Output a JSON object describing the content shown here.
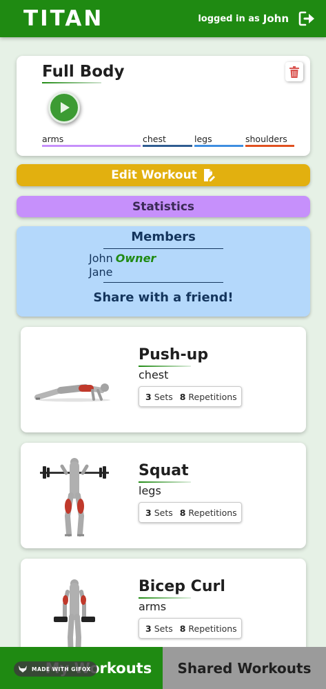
{
  "header": {
    "brand": "TITAN",
    "login_text": "logged in as",
    "username": "John",
    "logout_icon": "sign-out-icon"
  },
  "workout": {
    "title": "Full Body",
    "delete_icon": "trash-icon",
    "play_icon": "play-icon",
    "tags": [
      {
        "label": "arms",
        "color": "#c690fb"
      },
      {
        "label": "chest",
        "color": "#2f5c91"
      },
      {
        "label": "legs",
        "color": "#3e8ee0"
      },
      {
        "label": "shoulders",
        "color": "#e0501f"
      }
    ]
  },
  "actions": {
    "edit_label": "Edit Workout",
    "edit_icon": "file-edit-icon",
    "stats_label": "Statistics"
  },
  "members": {
    "title": "Members",
    "list": [
      {
        "name": "John",
        "role": "Owner"
      },
      {
        "name": "Jane",
        "role": ""
      }
    ],
    "share_label": "Share with a friend!"
  },
  "exercises": [
    {
      "name": "Push-up",
      "muscle": "chest",
      "sets": "3",
      "sets_label": "Sets",
      "reps": "8",
      "reps_label": "Repetitions",
      "image": "push-up-illustration"
    },
    {
      "name": "Squat",
      "muscle": "legs",
      "sets": "3",
      "sets_label": "Sets",
      "reps": "8",
      "reps_label": "Repetitions",
      "image": "squat-illustration"
    },
    {
      "name": "Bicep Curl",
      "muscle": "arms",
      "sets": "3",
      "sets_label": "Sets",
      "reps": "8",
      "reps_label": "Repetitions",
      "image": "bicep-curl-illustration"
    }
  ],
  "bottom_nav": {
    "my_workouts": "My Workouts",
    "shared_workouts": "Shared Workouts",
    "watermark": "MADE WITH GIFOX"
  },
  "colors": {
    "primary_green": "#1f8a12",
    "edit_yellow": "#e2b00f",
    "stats_purple": "#c690fb",
    "members_blue": "#b4d8fb",
    "delete_red": "#d9534f"
  }
}
